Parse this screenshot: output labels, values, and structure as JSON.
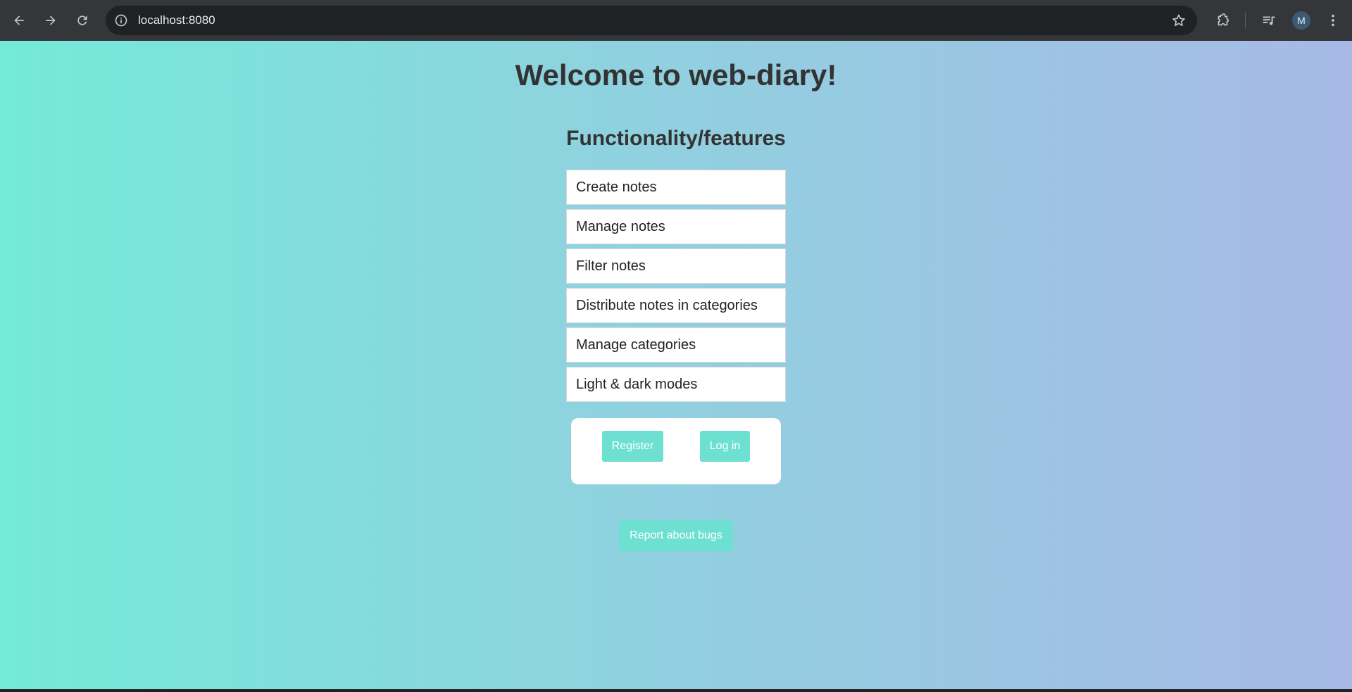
{
  "browser": {
    "url": "localhost:8080",
    "profile_initial": "M",
    "icons": {
      "back": "back-arrow-icon",
      "forward": "forward-arrow-icon",
      "reload": "reload-icon",
      "site_info": "info-icon",
      "bookmark": "star-icon",
      "extensions": "puzzle-icon",
      "media": "media-queue-icon",
      "menu": "kebab-menu-icon"
    }
  },
  "page": {
    "title": "Welcome to web-diary!",
    "features_heading": "Functionality/features",
    "features": [
      "Create notes",
      "Manage notes",
      "Filter notes",
      "Distribute notes in categories",
      "Manage categories",
      "Light & dark modes"
    ],
    "auth": {
      "register_label": "Register",
      "login_label": "Log in"
    },
    "report_bugs_label": "Report about bugs"
  },
  "colors": {
    "gradient_start": "#74ead8",
    "gradient_end": "#a7b9e6",
    "button": "#6ee0d2",
    "heading": "#333333",
    "chrome": "#35363a"
  }
}
